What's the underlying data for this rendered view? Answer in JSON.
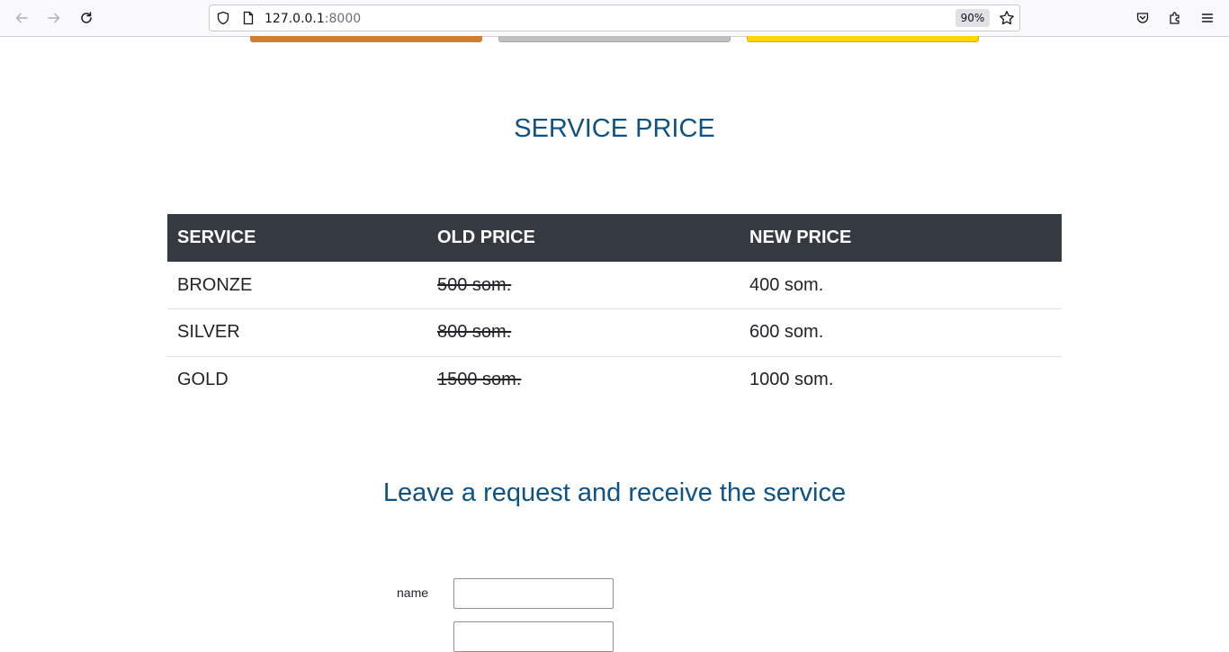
{
  "browser": {
    "url_host": "127.0.0.1",
    "url_port": ":8000",
    "zoom": "90%",
    "icons": [
      "back-icon",
      "forward-icon",
      "reload-icon",
      "shield-icon",
      "page-icon",
      "star-icon",
      "pocket-icon",
      "extensions-icon",
      "menu-icon"
    ]
  },
  "top_buttons": {
    "colors": [
      "#cd7f32",
      "#c0c0c0",
      "#ffd700"
    ]
  },
  "price_section": {
    "title": "SERVICE PRICE",
    "columns": [
      "SERVICE",
      "OLD PRICE",
      "NEW PRICE"
    ],
    "rows": [
      {
        "service": "BRONZE",
        "old_price": "500 som.",
        "new_price": "400 som."
      },
      {
        "service": "SILVER",
        "old_price": "800 som.",
        "new_price": "600 som."
      },
      {
        "service": "GOLD",
        "old_price": "1500 som.",
        "new_price": "1000 som."
      }
    ]
  },
  "request_section": {
    "title": "Leave a request and receive the service",
    "name_label": "name",
    "name_value": ""
  },
  "colors": {
    "accent": "#0f5283",
    "table_header": "#343a40"
  }
}
